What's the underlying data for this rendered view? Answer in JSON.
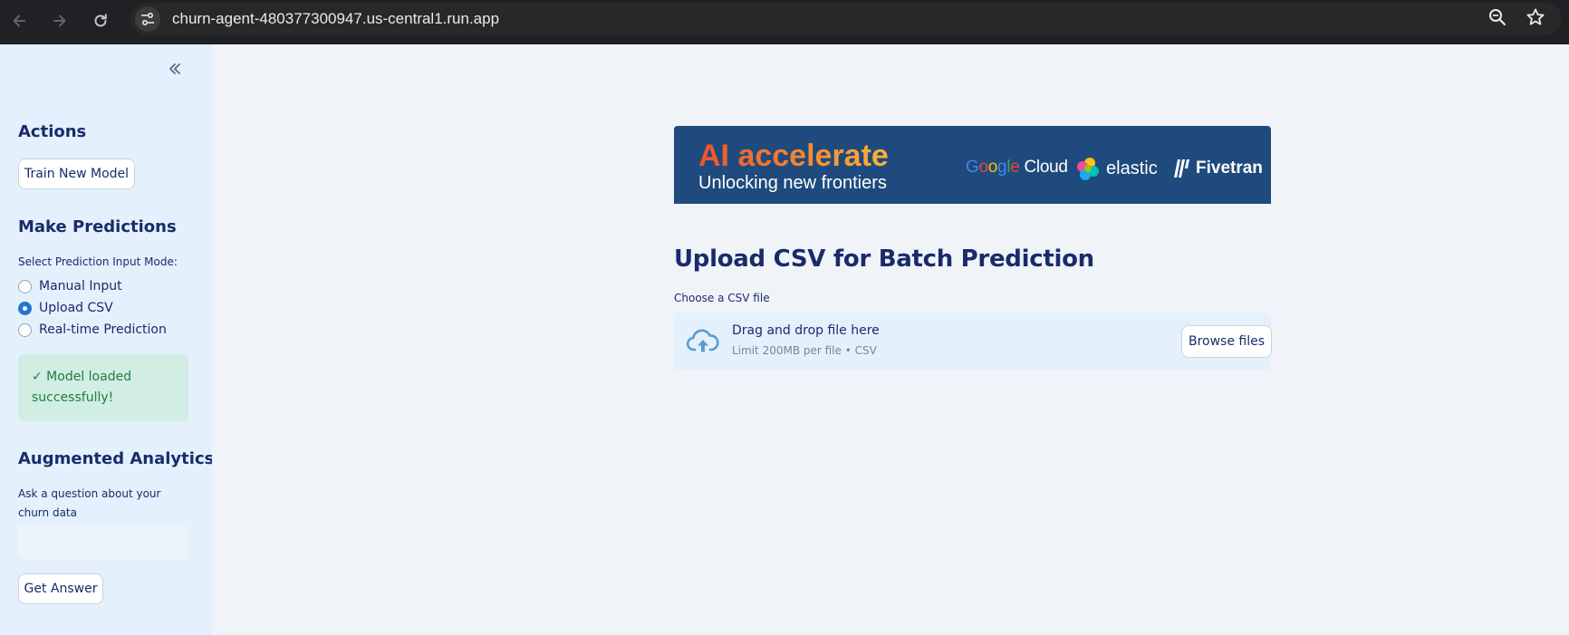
{
  "browser": {
    "url": "churn-agent-480377300947.us-central1.run.app",
    "icons": [
      "back-icon",
      "forward-icon",
      "reload-icon",
      "site-info-icon",
      "zoom-icon",
      "star-icon"
    ]
  },
  "sidebar": {
    "collapse_icon": "double-chevron-left-icon",
    "actions_heading": "Actions",
    "train_button": "Train New Model",
    "predictions_heading": "Make Predictions",
    "mode_label": "Select Prediction Input Mode:",
    "modes": [
      {
        "label": "Manual Input",
        "checked": false
      },
      {
        "label": "Upload CSV",
        "checked": true
      },
      {
        "label": "Real-time Prediction",
        "checked": false
      }
    ],
    "success_message": "✓ Model loaded successfully!",
    "analytics_heading": "Augmented Analytics",
    "question_label": "Ask a question about your churn data",
    "question_value": "",
    "answer_button": "Get Answer"
  },
  "main": {
    "banner": {
      "title": "AI accelerate",
      "subtitle": "Unlocking new frontiers",
      "google_letters": [
        "G",
        "o",
        "o",
        "g",
        "l",
        "e"
      ],
      "google_colors": [
        "#4285F4",
        "#EA4335",
        "#FBBC05",
        "#4285F4",
        "#34A853",
        "#EA4335"
      ],
      "google_cloud": " Cloud",
      "elastic": "elastic",
      "fivetran": "Fivetran"
    },
    "page_title": "Upload CSV for Batch Prediction",
    "file_label": "Choose a CSV file",
    "dropzone": {
      "icon": "cloud-upload-icon",
      "title": "Drag and drop file here",
      "subtitle": "Limit 200MB per file • CSV",
      "browse_button": "Browse files"
    }
  },
  "colors": {
    "accent": "#1f78d1",
    "text_primary": "#1a2b6b",
    "success_bg": "#d2ede3",
    "success_text": "#1f7f3e",
    "banner_bg": "#1f4a7d",
    "sidebar_bg": "#e4f0fc",
    "main_bg": "#f0f4f9"
  }
}
